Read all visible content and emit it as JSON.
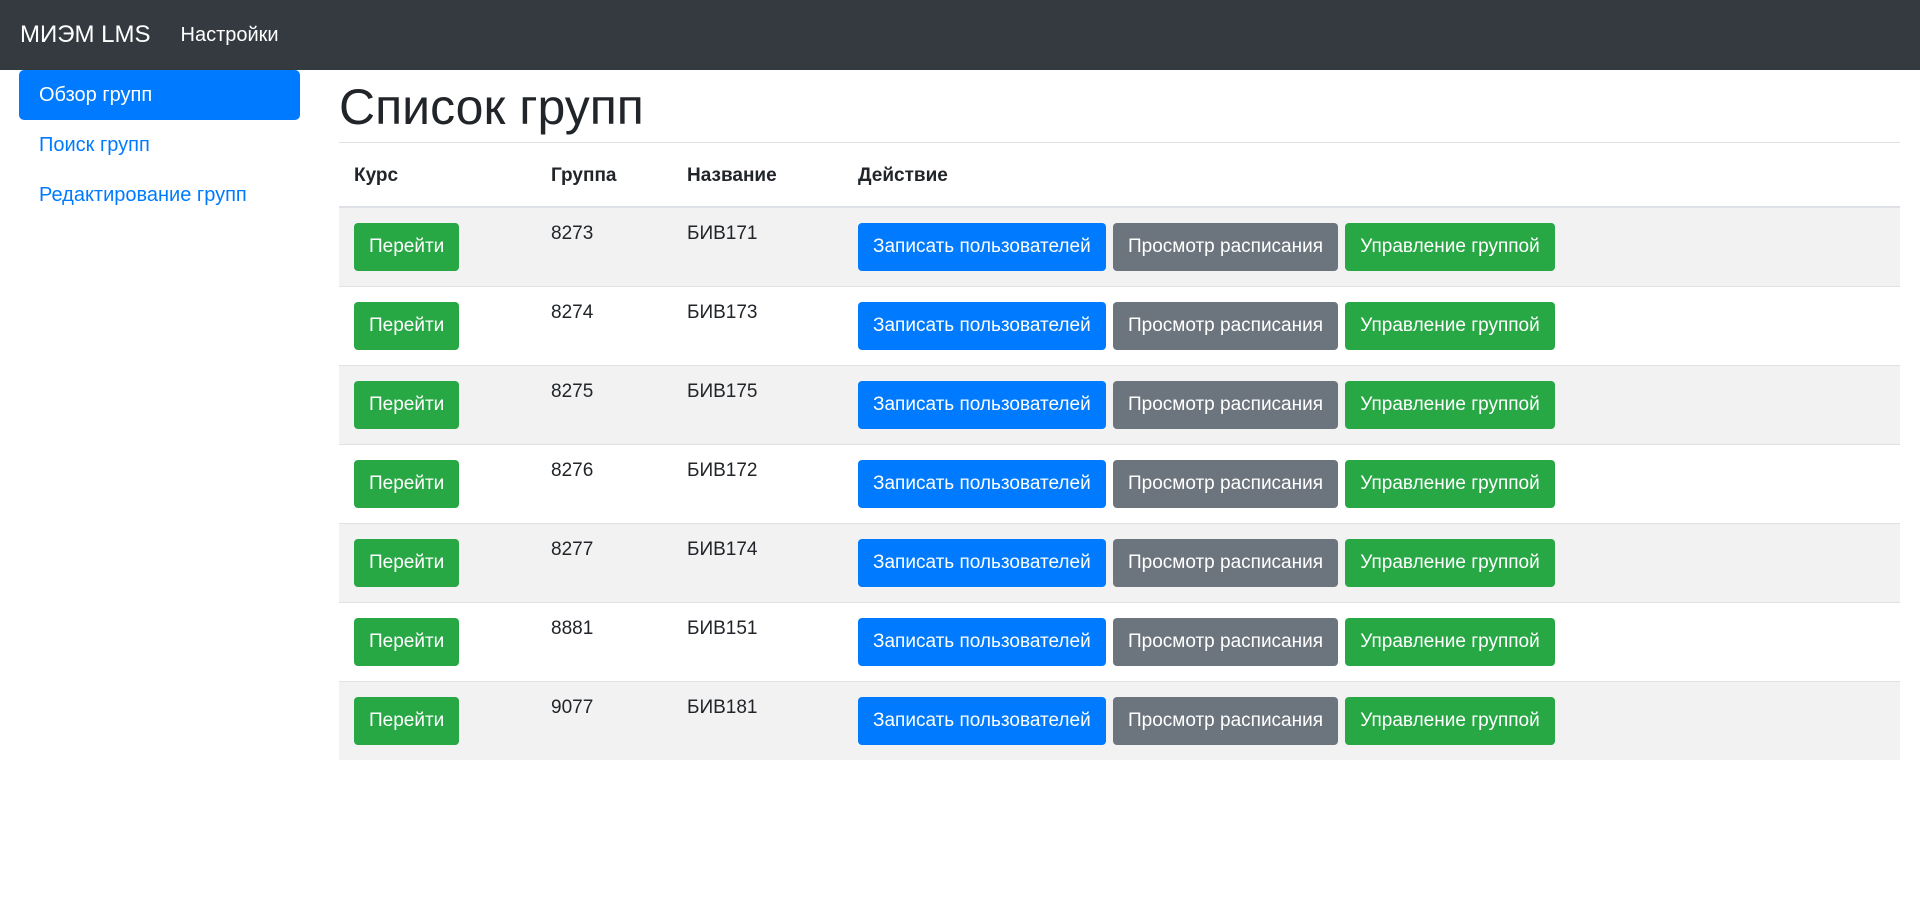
{
  "navbar": {
    "brand": "МИЭМ LMS",
    "settings": "Настройки"
  },
  "sidebar": {
    "items": [
      {
        "label": "Обзор групп",
        "active": true
      },
      {
        "label": "Поиск групп"
      },
      {
        "label": "Редактирование групп"
      }
    ]
  },
  "main": {
    "title": "Список групп",
    "columns": [
      "Курс",
      "Группа",
      "Название",
      "Действие"
    ],
    "buttons": {
      "go": "Перейти",
      "enroll": "Записать пользователей",
      "schedule": "Просмотр расписания",
      "manage": "Управление группой"
    },
    "rows": [
      {
        "group": "8273",
        "name": "БИВ171"
      },
      {
        "group": "8274",
        "name": "БИВ173"
      },
      {
        "group": "8275",
        "name": "БИВ175"
      },
      {
        "group": "8276",
        "name": "БИВ172"
      },
      {
        "group": "8277",
        "name": "БИВ174"
      },
      {
        "group": "8881",
        "name": "БИВ151"
      },
      {
        "group": "9077",
        "name": "БИВ181"
      }
    ]
  },
  "colors": {
    "navbar": "#343a40",
    "primary": "#007bff",
    "secondary": "#6c757d",
    "success": "#28a745"
  }
}
